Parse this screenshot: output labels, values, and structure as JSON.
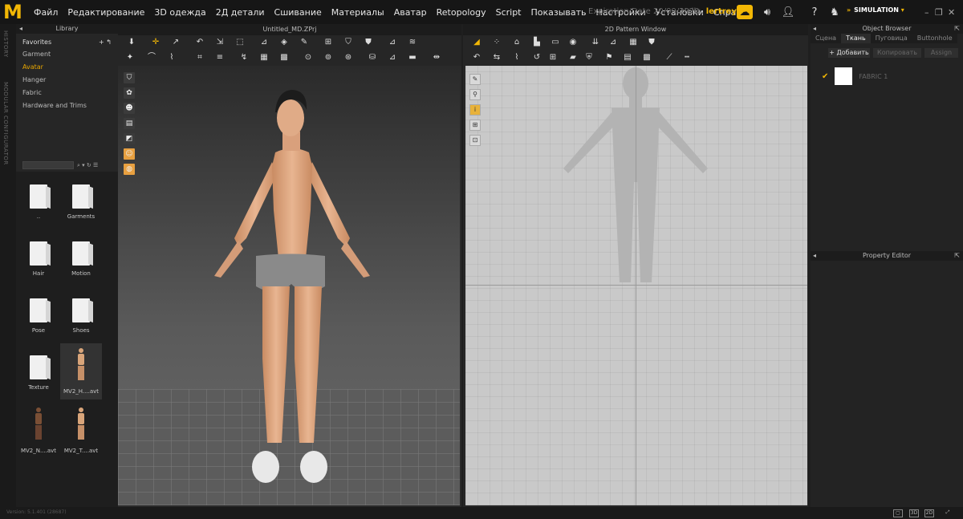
{
  "app": {
    "logo": "M"
  },
  "menu": [
    "Файл",
    "Редактирование",
    "3D одежда",
    "2Д детали",
    "Сшивание",
    "Материалы",
    "Аватар",
    "Retopology",
    "Script",
    "Показывать",
    "Настройки",
    "Установки",
    "Справка"
  ],
  "account": {
    "expiration": "Expiration Date 20/09/2020",
    "hello": "Hello,",
    "user": "lertreyer",
    "mode": "SIMULATION"
  },
  "side": {
    "history": "HISTORY",
    "modular": "MODULAR CONFIGURATOR"
  },
  "library": {
    "title": "Library",
    "favorites": "Favorites",
    "items": [
      "Garment",
      "Avatar",
      "Hanger",
      "Fabric",
      "Hardware and Trims"
    ],
    "active": "Avatar",
    "thumbs": [
      {
        "label": "..",
        "kind": "folder"
      },
      {
        "label": "Garments",
        "kind": "folder"
      },
      {
        "label": "Hair",
        "kind": "folder"
      },
      {
        "label": "Motion",
        "kind": "folder"
      },
      {
        "label": "Pose",
        "kind": "folder"
      },
      {
        "label": "Shoes",
        "kind": "folder"
      },
      {
        "label": "Texture",
        "kind": "folder"
      },
      {
        "label": "MV2_H....avt",
        "kind": "avatar"
      },
      {
        "label": "MV2_N....avt",
        "kind": "avatar-dark"
      },
      {
        "label": "MV2_T....avt",
        "kind": "avatar"
      }
    ]
  },
  "view3d": {
    "title": "Untitled_MD.ZPrj"
  },
  "view2d": {
    "title": "2D Pattern Window"
  },
  "object_browser": {
    "title": "Object Browser",
    "tabs": [
      "Сцена",
      "Ткань",
      "Пуговица",
      "Buttonhole"
    ],
    "active_tab": "Ткань",
    "add": "+ Добавить",
    "copy": "Копировать",
    "assign": "Assign",
    "fabric": "FABRIC 1"
  },
  "property_editor": {
    "title": "Property Editor"
  },
  "status": {
    "version": "Version: 5.1.401 (28687)",
    "views": [
      "▢",
      "3D",
      "2D",
      "⤢"
    ]
  }
}
